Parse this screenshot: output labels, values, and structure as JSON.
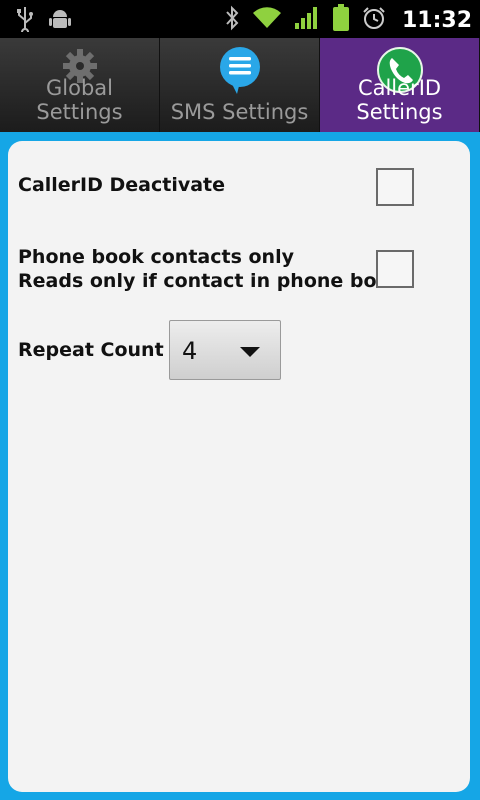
{
  "status_bar": {
    "time": "11:32",
    "icons": [
      "usb-icon",
      "android-debug-icon",
      "bluetooth-icon",
      "wifi-icon",
      "signal-icon",
      "battery-icon",
      "alarm-icon"
    ]
  },
  "tabs": [
    {
      "label": "Global Settings",
      "icon": "gear-icon",
      "selected": false
    },
    {
      "label": "SMS Settings",
      "icon": "sms-bubble-icon",
      "selected": false
    },
    {
      "label": "CallerID Settings",
      "icon": "phone-icon",
      "selected": true
    }
  ],
  "settings": {
    "deactivate_label": "CallerID Deactivate",
    "deactivate_checked": false,
    "phonebook_label": "Phone book contacts only",
    "phonebook_desc": "Reads only if contact in phone book",
    "phonebook_checked": false,
    "repeat_label": "Repeat Count",
    "repeat_value": "4"
  },
  "colors": {
    "background": "#15a6e6",
    "selected_tab": "#5b2a86"
  }
}
